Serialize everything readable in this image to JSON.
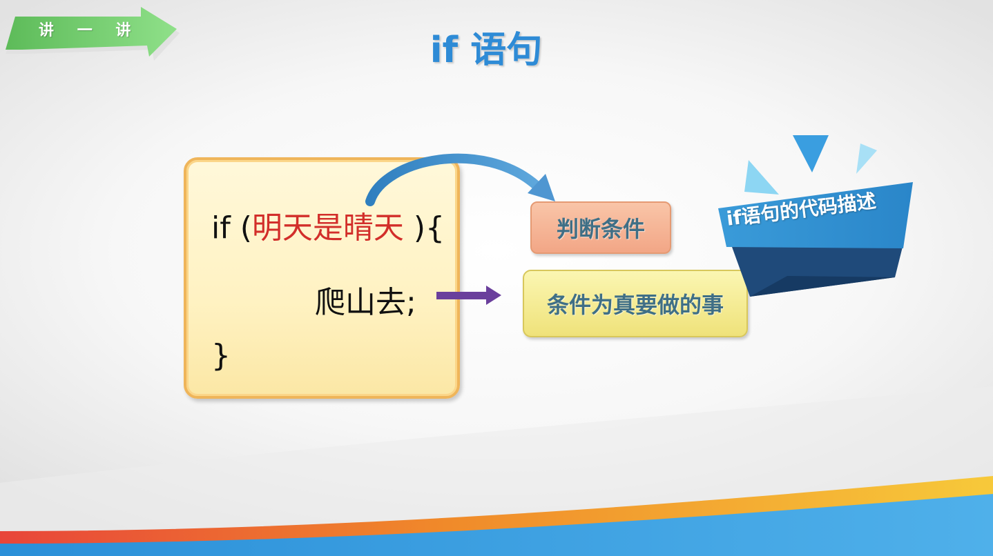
{
  "badge": {
    "chars": [
      "讲",
      "一",
      "讲"
    ]
  },
  "title": "if 语句",
  "code": {
    "line1_prefix": "if (",
    "line1_condition": "明天是晴天",
    "line1_suffix": " ){",
    "line2": "爬山去;",
    "line3": "}"
  },
  "labels": {
    "condition": "判断条件",
    "action": "条件为真要做的事"
  },
  "ribbon": {
    "text": "if语句的代码描述"
  },
  "colors": {
    "title": "#2e8bd6",
    "condition_text": "#d22e2a",
    "badge_green": "#6fcf6a",
    "ribbon_blue": "#2f94d8",
    "arrow_purple": "#6a3f9c"
  }
}
